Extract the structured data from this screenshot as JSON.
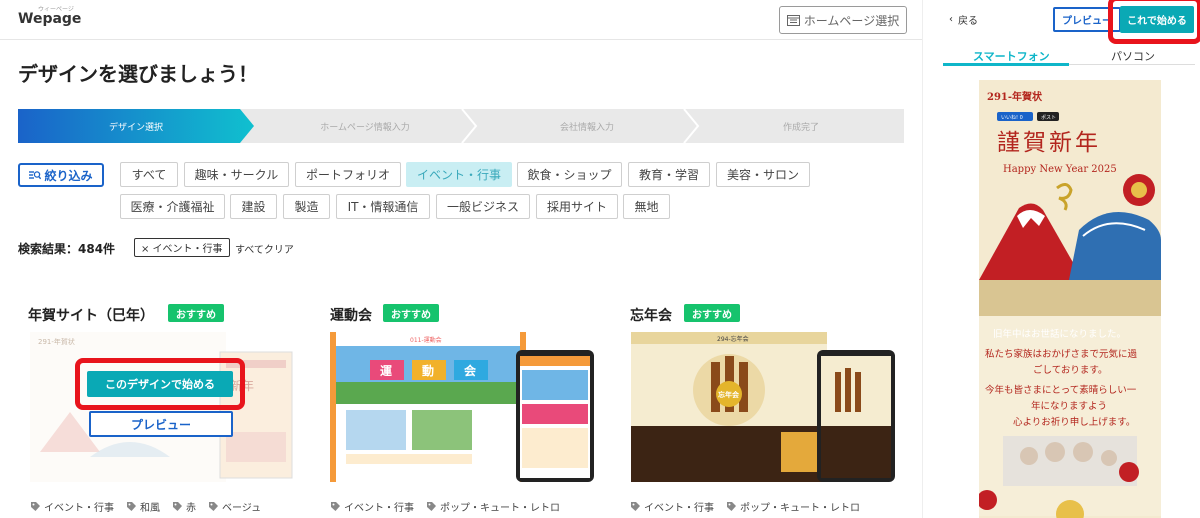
{
  "header": {
    "logo": "Wepage",
    "logo_sub": "ウィーページ",
    "hp_select_label": "ホームページ選択"
  },
  "page_title": "デザインを選びましょう！",
  "steps": [
    "デザイン選択",
    "ホームページ情報入力",
    "会社情報入力",
    "作成完了"
  ],
  "filters": {
    "refine_label": "絞り込み",
    "row1": [
      "すべて",
      "趣味・サークル",
      "ポートフォリオ",
      "イベント・行事",
      "飲食・ショップ",
      "教育・学習",
      "美容・サロン"
    ],
    "row2": [
      "医療・介護福祉",
      "建設",
      "製造",
      "IT・情報通信",
      "一般ビジネス",
      "採用サイト",
      "無地"
    ],
    "active": "イベント・行事"
  },
  "results": {
    "count_label": "検索結果：484件",
    "active_tag": "× イベント・行事",
    "clear_label": "すべてクリア"
  },
  "cards": [
    {
      "title": "年賀サイト（巳年）",
      "badge": "おすすめ",
      "start_label": "このデザインで始める",
      "preview_label": "プレビュー",
      "tags": [
        "イベント・行事",
        "和風",
        "赤",
        "ベージュ"
      ]
    },
    {
      "title": "運動会",
      "badge": "おすすめ",
      "thumb_text": [
        "運",
        "動",
        "会"
      ],
      "thumb_site": "011-運動会",
      "tags": [
        "イベント・行事",
        "ポップ・キュート・レトロ"
      ]
    },
    {
      "title": "忘年会",
      "badge": "おすすめ",
      "thumb_site": "294-忘年会",
      "thumb_text": "忘年会",
      "tags": [
        "イベント・行事",
        "ポップ・キュート・レトロ"
      ]
    }
  ],
  "panel": {
    "back_label": "戻る",
    "preview_label": "プレビュー",
    "start_label": "これで始める",
    "tabs": [
      "スマートフォン",
      "パソコン"
    ],
    "active_tab": "スマートフォン",
    "phone": {
      "site_name": "291-年賀状",
      "like": "いいね! 0",
      "post": "ポスト",
      "heading": "謹賀新年",
      "sub": "Happy New Year 2025",
      "message": [
        "旧年中はお世話になりました。",
        "私たち家族はおかげさまで元気に過",
        "ごしております。",
        "今年も皆さまにとって素晴らしい一",
        "年になりますよう",
        "心よりお祈り申し上げます。"
      ]
    }
  },
  "colors": {
    "accent_teal": "#0aa9b5",
    "accent_blue": "#1a63c9",
    "badge_green": "#16c36d",
    "highlight_red": "#e8141c"
  }
}
